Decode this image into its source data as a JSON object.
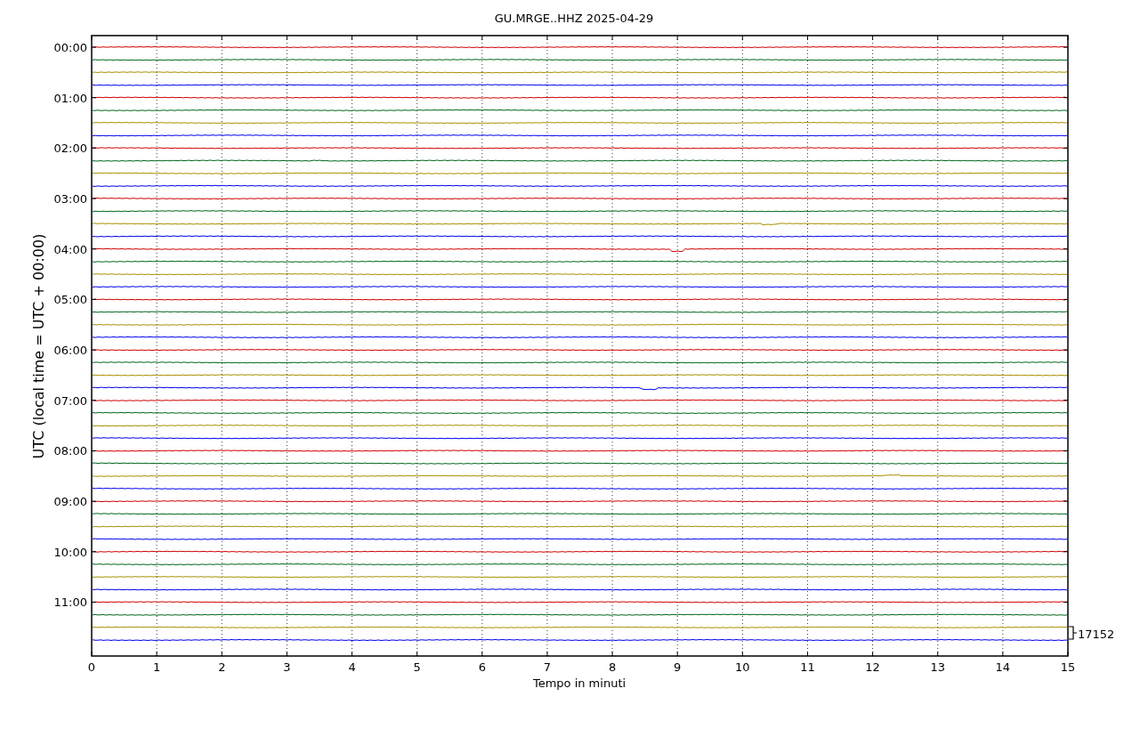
{
  "title": "GU.MRGE..HHZ 2025-04-29",
  "ylabel": "UTC (local time = UTC + 00:00)",
  "xlabel": "Tempo in minuti",
  "xticks": [
    "0",
    "1",
    "2",
    "3",
    "4",
    "5",
    "6",
    "7",
    "8",
    "9",
    "10",
    "11",
    "12",
    "13",
    "14",
    "15"
  ],
  "yticks": [
    "00:00",
    "01:00",
    "02:00",
    "03:00",
    "04:00",
    "05:00",
    "06:00",
    "07:00",
    "08:00",
    "09:00",
    "10:00",
    "11:00"
  ],
  "scale_label": "17152",
  "traces": [
    {
      "color": "#d00000"
    },
    {
      "color": "#00661a"
    },
    {
      "color": "#a89000"
    },
    {
      "color": "#0000ee"
    },
    {
      "color": "#d00000"
    },
    {
      "color": "#00661a"
    },
    {
      "color": "#a89000"
    },
    {
      "color": "#0000ee"
    },
    {
      "color": "#d00000"
    },
    {
      "color": "#00661a"
    },
    {
      "color": "#a89000"
    },
    {
      "color": "#0000ee"
    },
    {
      "color": "#d00000"
    },
    {
      "color": "#00661a"
    },
    {
      "color": "#a89000"
    },
    {
      "color": "#0000ee"
    },
    {
      "color": "#d00000"
    },
    {
      "color": "#00661a"
    },
    {
      "color": "#a89000"
    },
    {
      "color": "#0000ee"
    },
    {
      "color": "#d00000"
    },
    {
      "color": "#00661a"
    },
    {
      "color": "#a89000"
    },
    {
      "color": "#0000ee"
    },
    {
      "color": "#d00000"
    },
    {
      "color": "#00661a"
    },
    {
      "color": "#a89000"
    },
    {
      "color": "#0000ee"
    },
    {
      "color": "#d00000"
    },
    {
      "color": "#00661a"
    },
    {
      "color": "#a89000"
    },
    {
      "color": "#0000ee"
    },
    {
      "color": "#d00000"
    },
    {
      "color": "#00661a"
    },
    {
      "color": "#a89000"
    },
    {
      "color": "#0000ee"
    },
    {
      "color": "#d00000"
    },
    {
      "color": "#00661a"
    },
    {
      "color": "#a89000"
    },
    {
      "color": "#0000ee"
    },
    {
      "color": "#d00000"
    },
    {
      "color": "#00661a"
    },
    {
      "color": "#a89000"
    },
    {
      "color": "#0000ee"
    },
    {
      "color": "#d00000"
    },
    {
      "color": "#00661a"
    },
    {
      "color": "#a89000"
    },
    {
      "color": "#0000ee"
    }
  ]
}
